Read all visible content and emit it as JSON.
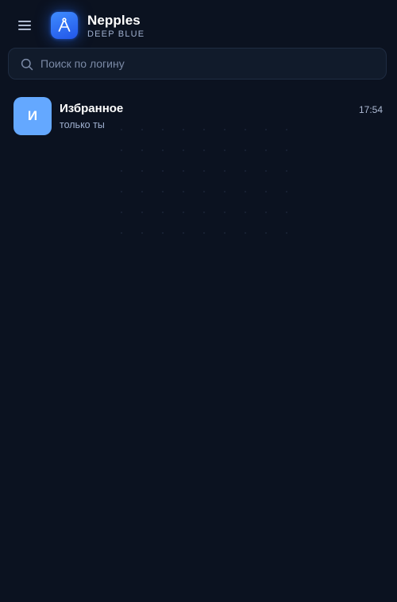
{
  "app": {
    "title": "Nepples",
    "subtitle": "DEEP BLUE",
    "logo_icon": "compass-icon",
    "menu_icon": "hamburger-menu-icon"
  },
  "search": {
    "placeholder": "Поиск по логину",
    "value": "",
    "icon": "search-icon"
  },
  "chats": [
    {
      "avatar_letter": "И",
      "name": "Избранное",
      "preview": "только ты",
      "time": "17:54",
      "avatar_color": "#64a8ff"
    }
  ],
  "colors": {
    "background": "#0b1220",
    "accent": "#2f6cff",
    "search_bg": "#111b2b"
  }
}
